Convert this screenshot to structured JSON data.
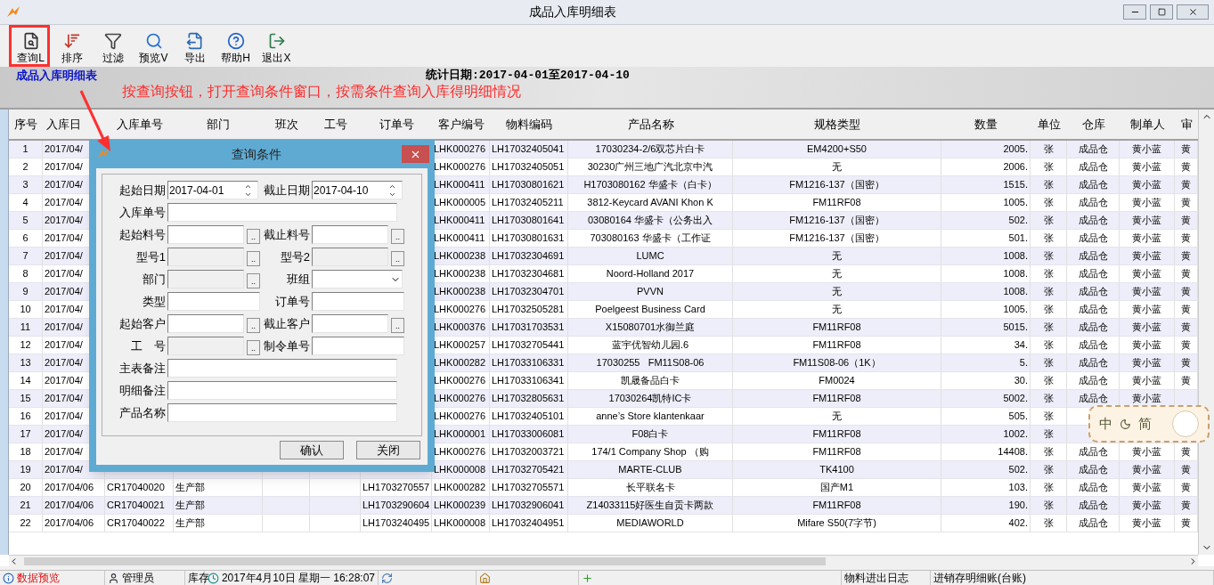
{
  "window": {
    "title": "成品入库明细表"
  },
  "toolbar": [
    {
      "kind": "query",
      "label": "查询L"
    },
    {
      "kind": "sort",
      "label": "排序"
    },
    {
      "kind": "filter",
      "label": "过滤"
    },
    {
      "kind": "preview",
      "label": "预览V"
    },
    {
      "kind": "export",
      "label": "导出"
    },
    {
      "kind": "help",
      "label": "帮助H"
    },
    {
      "kind": "exit",
      "label": "退出X"
    }
  ],
  "report_header": {
    "title": "成品入库明细表",
    "date_range": "统计日期:2017-04-01至2017-04-10"
  },
  "annotation": {
    "text": "按查询按钮，打开查询条件窗口，按需条件查询入库得明细情况"
  },
  "table": {
    "columns": [
      "序号",
      "入库日",
      "入库单号",
      "部门",
      "班次",
      "工号",
      "订单号",
      "客户编号",
      "物料编码",
      "产品名称",
      "规格类型",
      "数量",
      "单位",
      "仓库",
      "制单人",
      "审"
    ],
    "rows": [
      {
        "no": "1",
        "date": "2017/04/",
        "customer": "LHK000276",
        "material": "LH17032405041",
        "product": "17030234-2/6双芯片白卡",
        "spec": "EM4200+S50",
        "qty": "2005.",
        "unit": "张",
        "warehouse": "成品仓",
        "maker": "黄小蓝",
        "reviewer": "黄"
      },
      {
        "no": "2",
        "date": "2017/04/",
        "customer": "LHK000276",
        "material": "LH17032405051",
        "product": "30230广州三地广汽北京中汽",
        "spec": "无",
        "qty": "2006.",
        "unit": "张",
        "warehouse": "成品仓",
        "maker": "黄小蓝",
        "reviewer": "黄"
      },
      {
        "no": "3",
        "date": "2017/04/",
        "customer": "LHK000411",
        "material": "LH17030801621",
        "product": "H1703080162 华盛卡（白卡）",
        "spec": "FM1216-137（国密）",
        "qty": "1515.",
        "unit": "张",
        "warehouse": "成品仓",
        "maker": "黄小蓝",
        "reviewer": "黄"
      },
      {
        "no": "4",
        "date": "2017/04/",
        "customer": "LHK000005",
        "material": "LH17032405211",
        "product": "3812-Keycard AVANI Khon K",
        "spec": "FM11RF08",
        "qty": "1005.",
        "unit": "张",
        "warehouse": "成品仓",
        "maker": "黄小蓝",
        "reviewer": "黄"
      },
      {
        "no": "5",
        "date": "2017/04/",
        "customer": "LHK000411",
        "material": "LH17030801641",
        "product": "03080164 华盛卡（公务出入",
        "spec": "FM1216-137（国密）",
        "qty": "502.",
        "unit": "张",
        "warehouse": "成品仓",
        "maker": "黄小蓝",
        "reviewer": "黄"
      },
      {
        "no": "6",
        "date": "2017/04/",
        "customer": "LHK000411",
        "material": "LH17030801631",
        "product": "703080163 华盛卡（工作证",
        "spec": "FM1216-137（国密）",
        "qty": "501.",
        "unit": "张",
        "warehouse": "成品仓",
        "maker": "黄小蓝",
        "reviewer": "黄"
      },
      {
        "no": "7",
        "date": "2017/04/",
        "customer": "LHK000238",
        "material": "LH17032304691",
        "product": "LUMC",
        "spec": "无",
        "qty": "1008.",
        "unit": "张",
        "warehouse": "成品仓",
        "maker": "黄小蓝",
        "reviewer": "黄"
      },
      {
        "no": "8",
        "date": "2017/04/",
        "customer": "LHK000238",
        "material": "LH17032304681",
        "product": "Noord-Holland 2017",
        "spec": "无",
        "qty": "1008.",
        "unit": "张",
        "warehouse": "成品仓",
        "maker": "黄小蓝",
        "reviewer": "黄"
      },
      {
        "no": "9",
        "date": "2017/04/",
        "customer": "LHK000238",
        "material": "LH17032304701",
        "product": "PVVN",
        "spec": "无",
        "qty": "1008.",
        "unit": "张",
        "warehouse": "成品仓",
        "maker": "黄小蓝",
        "reviewer": "黄"
      },
      {
        "no": "10",
        "date": "2017/04/",
        "customer": "LHK000276",
        "material": "LH17032505281",
        "product": "Poelgeest Business Card",
        "spec": "无",
        "qty": "1005.",
        "unit": "张",
        "warehouse": "成品仓",
        "maker": "黄小蓝",
        "reviewer": "黄"
      },
      {
        "no": "11",
        "date": "2017/04/",
        "customer": "LHK000376",
        "material": "LH17031703531",
        "product": "X15080701水御兰庭",
        "spec": "FM11RF08",
        "qty": "5015.",
        "unit": "张",
        "warehouse": "成品仓",
        "maker": "黄小蓝",
        "reviewer": "黄"
      },
      {
        "no": "12",
        "date": "2017/04/",
        "customer": "LHK000257",
        "material": "LH17032705441",
        "product": "蓝宇优智幼儿园.6",
        "spec": "FM11RF08",
        "qty": "34.",
        "unit": "张",
        "warehouse": "成品仓",
        "maker": "黄小蓝",
        "reviewer": "黄"
      },
      {
        "no": "13",
        "date": "2017/04/",
        "customer": "LHK000282",
        "material": "LH17033106331",
        "product": "17030255   FM11S08-06",
        "spec": "FM11S08-06（1K）",
        "qty": "5.",
        "unit": "张",
        "warehouse": "成品仓",
        "maker": "黄小蓝",
        "reviewer": "黄"
      },
      {
        "no": "14",
        "date": "2017/04/",
        "customer": "LHK000276",
        "material": "LH17033106341",
        "product": "凯晟备品白卡",
        "spec": "FM0024",
        "qty": "30.",
        "unit": "张",
        "warehouse": "成品仓",
        "maker": "黄小蓝",
        "reviewer": "黄"
      },
      {
        "no": "15",
        "date": "2017/04/",
        "customer": "LHK000276",
        "material": "LH17032805631",
        "product": "17030264凯特IC卡",
        "spec": "FM11RF08",
        "qty": "5002.",
        "unit": "张",
        "warehouse": "成品仓",
        "maker": "黄小蓝"
      },
      {
        "no": "16",
        "date": "2017/04/",
        "customer": "LHK000276",
        "material": "LH17032405101",
        "product": "anne’s Store klantenkaar",
        "spec": "无",
        "qty": "505.",
        "unit": "张"
      },
      {
        "no": "17",
        "date": "2017/04/",
        "customer": "LHK000001",
        "material": "LH17033006081",
        "product": "F08白卡",
        "spec": "FM11RF08",
        "qty": "1002.",
        "unit": "张"
      },
      {
        "no": "18",
        "date": "2017/04/",
        "customer": "LHK000276",
        "material": "LH17032003721",
        "product": "174/1 Company Shop （购",
        "spec": "FM11RF08",
        "qty": "14408.",
        "unit": "张",
        "warehouse": "成品仓",
        "maker": "黄小蓝",
        "reviewer": "黄"
      },
      {
        "no": "19",
        "date": "2017/04/",
        "customer": "LHK000008",
        "material": "LH17032705421",
        "product": "MARTE-CLUB",
        "spec": "TK4100",
        "qty": "502.",
        "unit": "张",
        "warehouse": "成品仓",
        "maker": "黄小蓝",
        "reviewer": "黄"
      },
      {
        "no": "20",
        "date": "2017/04/06",
        "receipt": "CR17040020",
        "department": "生产部",
        "order": "LH1703270557",
        "customer": "LHK000282",
        "material": "LH17032705571",
        "product": "长平联名卡",
        "spec": "国产M1",
        "qty": "103.",
        "unit": "张",
        "warehouse": "成品仓",
        "maker": "黄小蓝",
        "reviewer": "黄"
      },
      {
        "no": "21",
        "date": "2017/04/06",
        "receipt": "CR17040021",
        "department": "生产部",
        "order": "LH1703290604",
        "customer": "LHK000239",
        "material": "LH17032906041",
        "product": "Z14033115好医生自贡卡两款",
        "spec": "FM11RF08",
        "qty": "190.",
        "unit": "张",
        "warehouse": "成品仓",
        "maker": "黄小蓝",
        "reviewer": "黄"
      },
      {
        "no": "22",
        "date": "2017/04/06",
        "receipt": "CR17040022",
        "department": "生产部",
        "order": "LH1703240495",
        "customer": "LHK000008",
        "material": "LH17032404951",
        "product": "MEDIAWORLD",
        "spec": "Mifare S50(7字节)",
        "qty": "402.",
        "unit": "张",
        "warehouse": "成品仓",
        "maker": "黄小蓝",
        "reviewer": "黄"
      }
    ]
  },
  "dialog": {
    "title": "查询条件",
    "rows": [
      {
        "fields": [
          {
            "label": "起始日期",
            "kind": "spin",
            "value": "2017-04-01",
            "disabled": false
          },
          {
            "label": "截止日期",
            "kind": "spin",
            "value": "2017-04-10",
            "disabled": false
          }
        ]
      },
      {
        "fields": [
          {
            "label": "入库单号",
            "kind": "text",
            "disabled": false
          }
        ]
      },
      {
        "fields": [
          {
            "label": "起始料号",
            "kind": "lookup",
            "button": "..",
            "disabled": false
          },
          {
            "label": "截止料号",
            "kind": "lookup",
            "button": "..",
            "disabled": false
          }
        ]
      },
      {
        "fields": [
          {
            "label": "型号1",
            "kind": "lookup",
            "button": "..",
            "disabled": true
          },
          {
            "label": "型号2",
            "kind": "lookup",
            "button": "..",
            "disabled": true
          }
        ]
      },
      {
        "fields": [
          {
            "label": "部门",
            "kind": "lookup",
            "button": "..",
            "disabled": true
          },
          {
            "label": "班组",
            "kind": "combo",
            "disabled": false
          }
        ]
      },
      {
        "fields": [
          {
            "label": "类型",
            "kind": "text",
            "disabled": false
          },
          {
            "label": "订单号",
            "kind": "text",
            "disabled": false
          }
        ]
      },
      {
        "fields": [
          {
            "label": "起始客户",
            "kind": "lookup",
            "button": "..",
            "disabled": false
          },
          {
            "label": "截止客户",
            "kind": "lookup",
            "button": "..",
            "disabled": false
          }
        ]
      },
      {
        "fields": [
          {
            "label": "工　号",
            "kind": "lookup",
            "button": "..",
            "disabled": true
          },
          {
            "label": "制令单号",
            "kind": "text",
            "disabled": false
          }
        ]
      },
      {
        "fields": [
          {
            "label": "主表备注",
            "kind": "text",
            "disabled": false
          }
        ]
      },
      {
        "fields": [
          {
            "label": "明细备注",
            "kind": "text",
            "disabled": false
          }
        ]
      },
      {
        "fields": [
          {
            "label": "产品名称",
            "kind": "text",
            "disabled": false
          }
        ]
      }
    ],
    "buttons": [
      "确认",
      "关闭"
    ]
  },
  "ime_toolbar": {
    "items": [
      "中",
      "简"
    ]
  },
  "status_bar": {
    "items": [
      {
        "kind": "info",
        "text": "数据预览"
      },
      {
        "kind": "user",
        "text": "管理员"
      },
      {
        "kind": "text",
        "text": "库存"
      },
      {
        "kind": "clock",
        "text": "2017年4月10日 星期一 16:28:07"
      },
      {
        "kind": "refresh"
      },
      {
        "kind": "home"
      },
      {
        "kind": "add"
      },
      {
        "kind": "text",
        "text": "物料进出日志"
      },
      {
        "kind": "text",
        "text": "进销存明细账(台账)"
      }
    ]
  }
}
